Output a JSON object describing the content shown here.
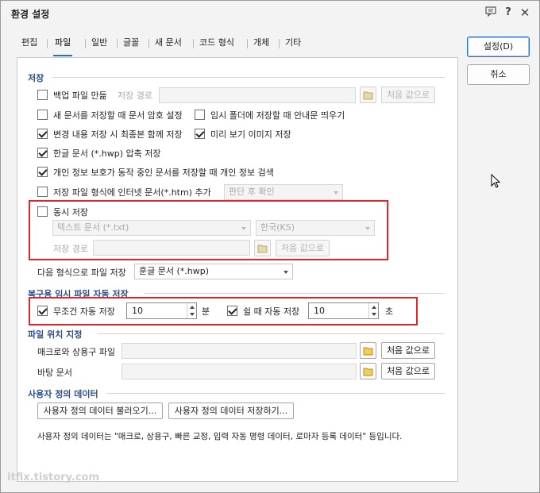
{
  "window": {
    "title": "환경 설정",
    "icons": [
      "chat-icon",
      "help-icon",
      "close-icon"
    ]
  },
  "tabs": [
    {
      "label": "편집",
      "active": false
    },
    {
      "label": "파일",
      "active": true
    },
    {
      "label": "일반",
      "active": false
    },
    {
      "label": "글꼴",
      "active": false
    },
    {
      "label": "새 문서",
      "active": false
    },
    {
      "label": "코드 형식",
      "active": false
    },
    {
      "label": "개체",
      "active": false
    },
    {
      "label": "기타",
      "active": false
    }
  ],
  "side_buttons": {
    "ok": "설정(D)",
    "cancel": "취소"
  },
  "save": {
    "heading": "저장",
    "backup": {
      "label": "백업 파일 만듦",
      "checked": false,
      "path_label": "저장 경로",
      "path_value": "",
      "default_button": "처음 값으로"
    },
    "password": {
      "label": "새 문서를 저장할 때 문서 암호 설정",
      "checked": false
    },
    "temp_folder_notice": {
      "label": "임시 폴더에 저장할 때 안내문 띄우기",
      "checked": false
    },
    "save_changes": {
      "label": "변경 내용 저장 시 최종본 함께 저장",
      "checked": true
    },
    "preview_image": {
      "label": "미리 보기 이미지 저장",
      "checked": true
    },
    "compress": {
      "label": "한글 문서 (*.hwp) 압축 저장",
      "checked": true
    },
    "privacy": {
      "label": "개인 정보 보호가 동작 중인 문서를 저장할 때 개인 정보 검색",
      "checked": true
    },
    "internet_doc": {
      "label": "저장 파일 형식에 인터넷 문서(*.htm) 추가",
      "checked": false,
      "combo_value": "판단 후 확인"
    },
    "simultaneous": {
      "label": "동시 저장",
      "checked": false,
      "format_value": "텍스트 문서 (*.txt)",
      "encoding_value": "한국(KS)",
      "path_label": "저장 경로",
      "path_value": "",
      "default_button": "처음 값으로"
    },
    "next_format": {
      "label": "다음 형식으로 파일 저장",
      "value": "훈글 문서 (*.hwp)"
    }
  },
  "autosave": {
    "heading": "복구용 임시 파일 자동 저장",
    "unconditional": {
      "label": "무조건 자동 저장",
      "checked": true,
      "value": "10",
      "unit": "분"
    },
    "idle": {
      "label": "쉴 때 자동 저장",
      "checked": true,
      "value": "10",
      "unit": "초"
    }
  },
  "file_location": {
    "heading": "파일 위치 지정",
    "macro": {
      "label": "매크로와 상용구 파일",
      "value": "",
      "default_button": "처음 값으로"
    },
    "background": {
      "label": "바탕 문서",
      "value": "",
      "default_button": "처음 값으로"
    }
  },
  "user_data": {
    "heading": "사용자 정의 데이터",
    "load_button": "사용자 정의 데이터 불러오기...",
    "save_button": "사용자 정의 데이터 저장하기...",
    "description": "사용자 정의 데이터는 \"매크로, 상용구, 빠른 교정, 입력 자동 명령 데이터, 로마자 등록 데이터\" 등입니다."
  },
  "watermark": "itfix.tistory.com",
  "colors": {
    "accent": "#2d6fbf",
    "heading": "#2b4f8a",
    "highlight": "#e0242c"
  }
}
